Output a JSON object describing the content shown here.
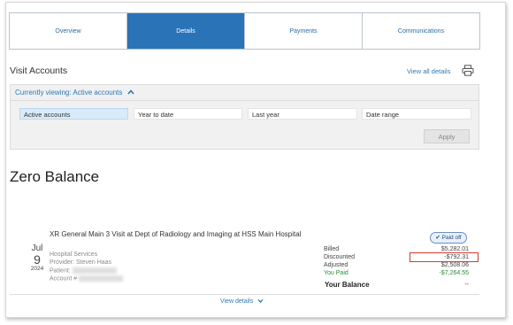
{
  "tabs": [
    {
      "label": "Overview",
      "active": false
    },
    {
      "label": "Details",
      "active": true
    },
    {
      "label": "Payments",
      "active": false
    },
    {
      "label": "Communications",
      "active": false
    }
  ],
  "visit_accounts": {
    "title": "Visit Accounts",
    "view_all_label": "View all details",
    "print_icon": "printer-icon"
  },
  "filter": {
    "currently_viewing": "Currently viewing: Active accounts",
    "options": [
      "Active accounts",
      "Year to date",
      "Last year",
      "Date range"
    ],
    "selected": "Active accounts",
    "apply_label": "Apply"
  },
  "section_title": "Zero Balance",
  "account": {
    "date": {
      "month": "Jul",
      "day": "9",
      "year": "2024"
    },
    "title": "XR General Main 3 Visit at Dept of Radiology and Imaging at HSS Main Hospital",
    "service": "Hospital Services",
    "provider": "Provider: Steven Haas",
    "patient_label": "Patient:",
    "account_label": "Account #",
    "status_badge": "Paid off",
    "financials": [
      {
        "label": "Billed",
        "value": "$5,282.01"
      },
      {
        "label": "Discounted",
        "value": "-$792.31"
      },
      {
        "label": "Adjusted",
        "value": "$2,508.06"
      },
      {
        "label": "You Paid",
        "value": "-$7,264.55"
      }
    ],
    "balance_label": "Your Balance",
    "balance_value": "--"
  },
  "view_details_label": "View details",
  "colors": {
    "tab_active": "#2a73b7",
    "link": "#2d78b5",
    "paid_green": "#2a8a3a",
    "highlight_red": "#d43a2f"
  }
}
